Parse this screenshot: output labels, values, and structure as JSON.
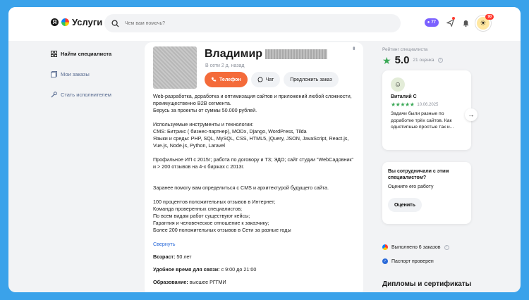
{
  "header": {
    "logo_text": "Услуги",
    "logo_ya": "Я",
    "search_placeholder": "Чем вам помочь?",
    "credits_badge": "77",
    "notifications_count": "90"
  },
  "sidebar": {
    "items": [
      {
        "label": "Найти специалиста"
      },
      {
        "label": "Мои заказы"
      },
      {
        "label": "Стать исполнителем"
      }
    ]
  },
  "profile": {
    "name": "Владимир",
    "online_status": "В сети 2 д. назад",
    "phone_button": "Телефон",
    "chat_button": "Чат",
    "offer_button": "Предложить заказ",
    "description": [
      "Web-разработка, доработка и оптимизация сайтов и приложений любой сложности, преимущественно B2B сегмента.\nБерусь за проекты от суммы 50.000 рублей.",
      "Используемые инструменты и технологии:\nCMS: Битрикс ( бизнес-партнер), MODx, Django, WordPress, Tilda\nЯзыки и среды: PHP, SQL, MySQL, CSS, HTML5, jQuery, JSON, JavaScript, React.js, Vue.js, Node.js, Python, Laravel",
      "Профильное ИП с 2015г; работа по договору и ТЗ; ЭДО; сайт студии \"WebСадовник\" и > 200 отзывов на 4-х биржах с 2013г.",
      "\nЗаранее помогу вам определиться с CMS и архитектурой будущего сайта.",
      "100 процентов положительных отзывов в Интернет;\nКоманда проверенных специалистов;\nПо всем видам работ существуют кейсы;\nГарантия и человеческое отношение к заказчику;\nБолее 200 положительных отзывов в Сети за разные годы"
    ],
    "collapse_link": "Свернуть",
    "age_label": "Возраст:",
    "age_value": "50 лет",
    "contact_time_label": "Удобное время для связи:",
    "contact_time_value": "с 9:00 до 21:00",
    "education_label": "Образование:",
    "education_value": "высшее РГГМИ"
  },
  "rating": {
    "label": "Рейтинг специалиста",
    "value": "5.0",
    "count": "21 оценка"
  },
  "review": {
    "author": "Виталий С",
    "date": "10.06.2025",
    "stars": "★★★★★",
    "text": "Задачи были разные по доработке трёх сайтов. Как однотипные простые так и..."
  },
  "cooperation": {
    "title": "Вы сотрудничали с этим специалистом?",
    "subtitle": "Оцените его работу",
    "rate_button": "Оценить"
  },
  "stats": {
    "orders_done": "Выполнено 6 заказов",
    "passport": "Паспорт проверен"
  },
  "diplomas": {
    "title": "Дипломы и сертификаты"
  },
  "colors": {
    "accent_orange": "#f46b3a",
    "rating_green": "#3aa856",
    "background_blue": "#3aa2ea",
    "link_blue": "#2a6ad9"
  }
}
